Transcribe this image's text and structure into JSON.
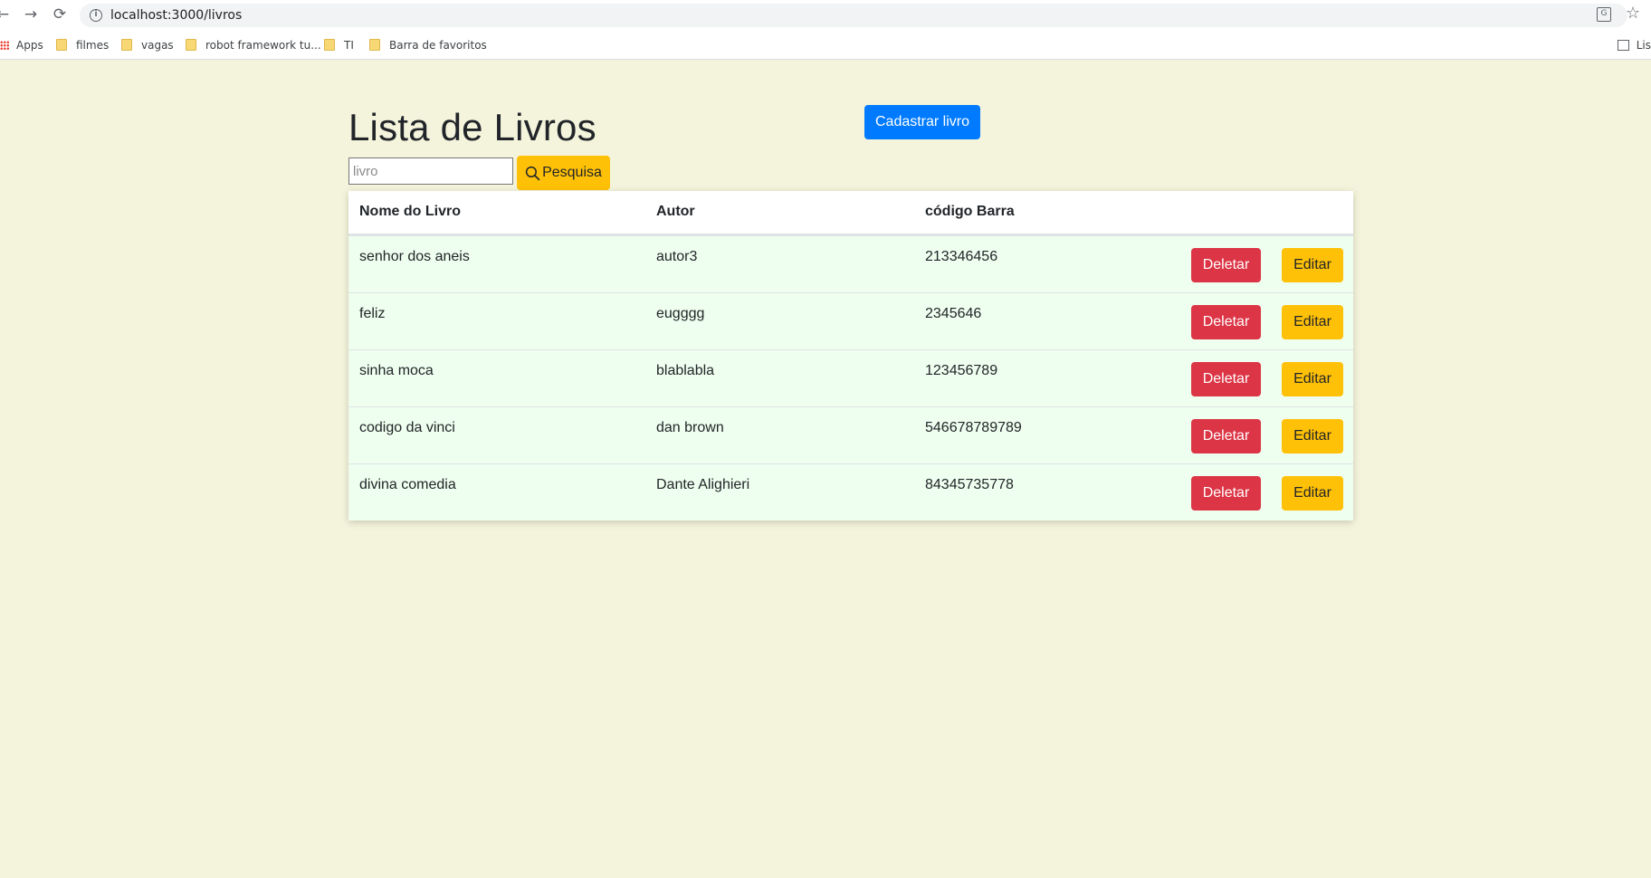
{
  "browser": {
    "url": "localhost:3000/livros",
    "nav": {
      "back": "←",
      "forward": "→",
      "reload": "⟳"
    },
    "bookmarks": [
      {
        "label": "Apps",
        "icon": "apps-icon"
      },
      {
        "label": "filmes",
        "icon": "folder-icon"
      },
      {
        "label": "vagas",
        "icon": "folder-icon"
      },
      {
        "label": "robot framework tu...",
        "icon": "folder-icon"
      },
      {
        "label": "TI",
        "icon": "folder-icon"
      },
      {
        "label": "Barra de favoritos",
        "icon": "folder-icon"
      }
    ],
    "reading_list_label": "Lis"
  },
  "page": {
    "title": "Lista de Livros",
    "add_button": "Cadastrar livro",
    "search": {
      "placeholder": "livro",
      "value": "",
      "button": "Pesquisa"
    }
  },
  "table": {
    "headers": [
      "Nome do Livro",
      "Autor",
      "código Barra"
    ],
    "delete_label": "Deletar",
    "edit_label": "Editar",
    "rows": [
      {
        "nome": "senhor dos aneis",
        "autor": "autor3",
        "codigo": "213346456"
      },
      {
        "nome": "feliz",
        "autor": "eugggg",
        "codigo": "2345646"
      },
      {
        "nome": "sinha moca",
        "autor": "blablabla",
        "codigo": "123456789"
      },
      {
        "nome": "codigo da vinci",
        "autor": "dan brown",
        "codigo": "546678789789"
      },
      {
        "nome": "divina comedia",
        "autor": "Dante Alighieri",
        "codigo": "84345735778"
      }
    ]
  },
  "colors": {
    "page_background": "#f4f4dc",
    "row_background": "#efffef",
    "primary": "#007bff",
    "warning": "#ffc107",
    "danger": "#dc3545"
  }
}
